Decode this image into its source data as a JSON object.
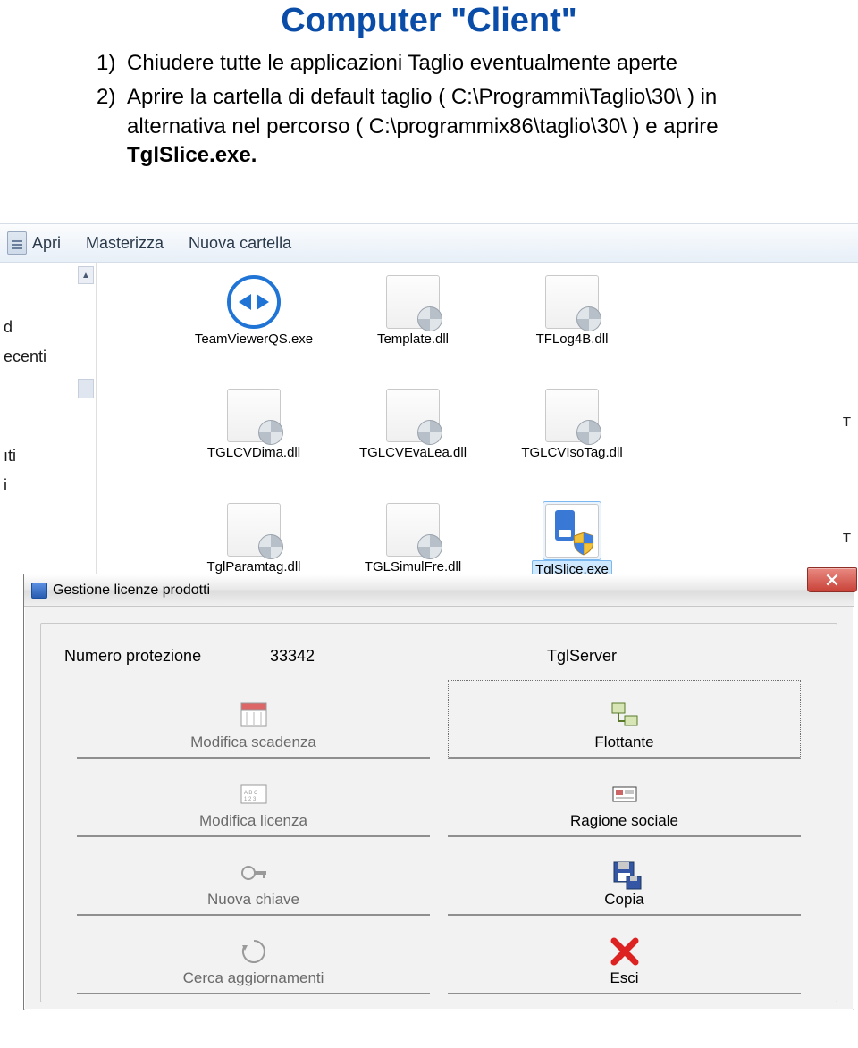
{
  "doc": {
    "title": "Computer \"Client\"",
    "steps": [
      {
        "num": "1)",
        "text": "Chiudere tutte le applicazioni Taglio eventualmente aperte"
      },
      {
        "num": "2)",
        "text_before": "Aprire la cartella di default taglio ( C:\\Programmi\\Taglio\\30\\ )  in alternativa nel percorso ( C:\\programmix86\\taglio\\30\\ ) e aprire ",
        "text_bold": "TglSlice.exe."
      }
    ]
  },
  "explorer": {
    "toolbar": {
      "apri": "Apri",
      "masterizza": "Masterizza",
      "nuova_cartella": "Nuova cartella"
    },
    "sidebar_fragments": [
      "d",
      "ecenti",
      "ıti",
      "i"
    ],
    "rows": [
      {
        "items": [
          {
            "type": "tv",
            "label": "TeamViewerQS.exe"
          },
          {
            "type": "dll",
            "label": "Template.dll"
          },
          {
            "type": "dll",
            "label": "TFLog4B.dll"
          }
        ],
        "trailing": ""
      },
      {
        "items": [
          {
            "type": "dll",
            "label": "TGLCVDima.dll"
          },
          {
            "type": "dll",
            "label": "TGLCVEvaLea.dll"
          },
          {
            "type": "dll",
            "label": "TGLCVIsoTag.dll"
          }
        ],
        "trailing": "T"
      },
      {
        "items": [
          {
            "type": "dll",
            "label": "TglParamtag.dll"
          },
          {
            "type": "dll",
            "label": "TGLSimulFre.dll"
          },
          {
            "type": "exe",
            "label": "TglSlice.exe",
            "selected": true
          }
        ],
        "trailing": "T"
      }
    ]
  },
  "dialog": {
    "title": "Gestione licenze prodotti",
    "header": {
      "label": "Numero protezione",
      "value": "33342",
      "server": "TglServer"
    },
    "left_buttons": [
      {
        "id": "modifica-scadenza",
        "label": "Modifica scadenza",
        "icon": "calendar"
      },
      {
        "id": "modifica-licenza",
        "label": "Modifica licenza",
        "icon": "license"
      },
      {
        "id": "nuova-chiave",
        "label": "Nuova chiave",
        "icon": "key"
      },
      {
        "id": "cerca-aggiornamenti",
        "label": "Cerca aggiornamenti",
        "icon": "update"
      }
    ],
    "right_buttons": [
      {
        "id": "flottante",
        "label": "Flottante",
        "icon": "network",
        "focus": true
      },
      {
        "id": "ragione-sociale",
        "label": "Ragione sociale",
        "icon": "card"
      },
      {
        "id": "copia",
        "label": "Copia",
        "icon": "floppy"
      },
      {
        "id": "esci",
        "label": "Esci",
        "icon": "cross"
      }
    ]
  }
}
